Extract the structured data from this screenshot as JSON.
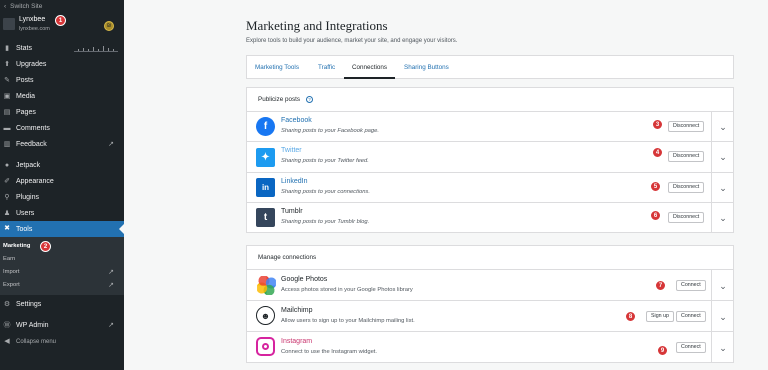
{
  "sidebar": {
    "switch_site": "Switch Site",
    "site_name": "Lynxbee",
    "site_url": "lynxbee.com",
    "items": [
      {
        "label": "Stats",
        "icon": "bar-chart-icon"
      },
      {
        "label": "Upgrades",
        "icon": "upgrades-icon"
      },
      {
        "label": "Posts",
        "icon": "pin-icon"
      },
      {
        "label": "Media",
        "icon": "media-icon"
      },
      {
        "label": "Pages",
        "icon": "pages-icon"
      },
      {
        "label": "Comments",
        "icon": "comments-icon"
      },
      {
        "label": "Feedback",
        "icon": "feedback-icon"
      },
      {
        "label": "Jetpack",
        "icon": "jetpack-icon"
      },
      {
        "label": "Appearance",
        "icon": "brush-icon"
      },
      {
        "label": "Plugins",
        "icon": "plug-icon"
      },
      {
        "label": "Users",
        "icon": "users-icon"
      },
      {
        "label": "Tools",
        "icon": "wrench-icon"
      }
    ],
    "submenu": [
      "Marketing",
      "Earn",
      "Import",
      "Export"
    ],
    "settings": "Settings",
    "wp_admin": "WP Admin",
    "collapse": "Collapse menu"
  },
  "header": {
    "title": "Marketing and Integrations",
    "subtitle": "Explore tools to build your audience, market your site, and engage your visitors."
  },
  "tabs": [
    "Marketing Tools",
    "Traffic",
    "Connections",
    "Sharing Buttons"
  ],
  "selected_tab": "Connections",
  "publicize": {
    "heading": "Publicize posts",
    "services": [
      {
        "name": "Facebook",
        "desc": "Sharing posts to your Facebook page.",
        "button": "Disconnect",
        "color": "#1877f2"
      },
      {
        "name": "Twitter",
        "desc": "Sharing posts to your Twitter feed.",
        "button": "Disconnect",
        "color": "#1d9bf0"
      },
      {
        "name": "LinkedIn",
        "desc": "Sharing posts to your connections.",
        "button": "Disconnect",
        "color": "#0a66c2"
      },
      {
        "name": "Tumblr",
        "desc": "Sharing posts to your Tumblr blog.",
        "button": "Disconnect",
        "color": "#35465c"
      }
    ]
  },
  "manage": {
    "heading": "Manage connections",
    "services": [
      {
        "name": "Google Photos",
        "desc": "Access photos stored in your Google Photos library",
        "button": "Connect"
      },
      {
        "name": "Mailchimp",
        "desc": "Allow users to sign up to your Mailchimp mailing list.",
        "button_primary": "Sign up",
        "button": "Connect"
      },
      {
        "name": "Instagram",
        "desc": "Connect to use the Instagram widget.",
        "button": "Connect"
      }
    ]
  },
  "badges": [
    "1",
    "2",
    "3",
    "4",
    "5",
    "6",
    "7",
    "8",
    "9"
  ],
  "colors": {
    "accent": "#2271b1",
    "sidebar": "#1d2327",
    "badge": "#d63638"
  }
}
